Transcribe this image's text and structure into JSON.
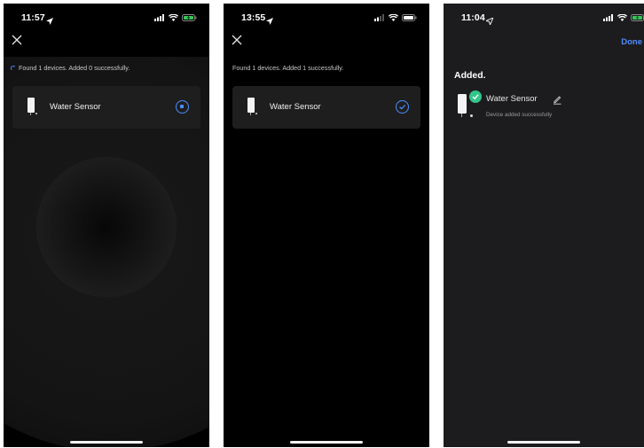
{
  "screens": [
    {
      "time": "11:57",
      "info_text": "Found 1 devices. Added 0 successfully.",
      "device_name": "Water Sensor",
      "status": "adding"
    },
    {
      "time": "13:55",
      "info_text": "Found 1 devices. Added 1 successfully.",
      "device_name": "Water Sensor",
      "status": "added"
    },
    {
      "time": "11:04",
      "done_label": "Done",
      "section_title": "Added.",
      "device_name": "Water Sensor",
      "message": "Device added successfully"
    }
  ],
  "icons": [
    "location-arrow-icon",
    "signal-icon",
    "wifi-icon",
    "battery-icon",
    "close-icon",
    "spinner-icon",
    "stop-icon",
    "checkmark-icon",
    "pencil-icon"
  ],
  "colors": {
    "accent": "#4d8dff",
    "success": "#34c58a",
    "battery_charging": "#34c759",
    "background_dark": "#000000",
    "card": "#1e1e1e"
  }
}
